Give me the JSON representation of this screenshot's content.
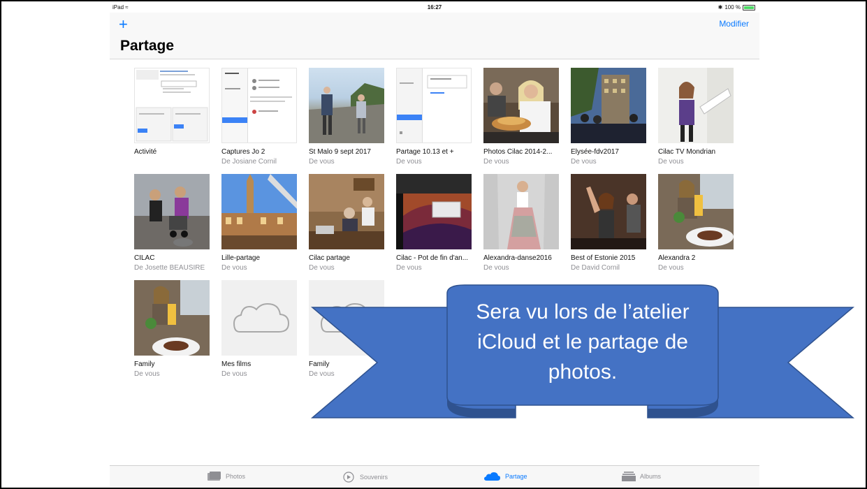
{
  "status": {
    "device": "iPad",
    "time": "16:27",
    "battery": "100 %"
  },
  "nav": {
    "add_label": "+",
    "edit_label": "Modifier",
    "title": "Partage"
  },
  "albums": [
    {
      "name": "Activité",
      "owner": ""
    },
    {
      "name": "Captures Jo 2",
      "owner": "De Josiane Cornil"
    },
    {
      "name": "St Malo 9 sept 2017",
      "owner": "De vous"
    },
    {
      "name": "Partage 10.13 et +",
      "owner": "De vous"
    },
    {
      "name": "Photos Cilac 2014-2...",
      "owner": "De vous"
    },
    {
      "name": "Elysée-fdv2017",
      "owner": "De vous"
    },
    {
      "name": "Cilac TV Mondrian",
      "owner": "De vous"
    },
    {
      "name": "CILAC",
      "owner": "De Josette BEAUSIRE"
    },
    {
      "name": "Lille-partage",
      "owner": "De vous"
    },
    {
      "name": "Cilac partage",
      "owner": "De vous"
    },
    {
      "name": "Cilac - Pot de fin d'an...",
      "owner": "De vous"
    },
    {
      "name": "Alexandra-danse2016",
      "owner": "De vous"
    },
    {
      "name": "Best of Estonie 2015",
      "owner": "De David Cornil"
    },
    {
      "name": "Alexandra 2",
      "owner": "De vous"
    },
    {
      "name": "Family",
      "owner": "De vous"
    },
    {
      "name": "Mes films",
      "owner": "De vous"
    },
    {
      "name": "Family",
      "owner": "De vous"
    }
  ],
  "tabs": [
    {
      "label": "Photos",
      "icon": "photos-icon"
    },
    {
      "label": "Souvenirs",
      "icon": "memories-icon"
    },
    {
      "label": "Partage",
      "icon": "cloud-icon",
      "active": true
    },
    {
      "label": "Albums",
      "icon": "albums-icon"
    }
  ],
  "banner": {
    "line1": "Sera vu lors de l’atelier",
    "line2": "iCloud et le partage de",
    "line3": "photos."
  },
  "colors": {
    "accent": "#0a7aff",
    "banner": "#4472c4",
    "banner_border": "#2f528f"
  }
}
